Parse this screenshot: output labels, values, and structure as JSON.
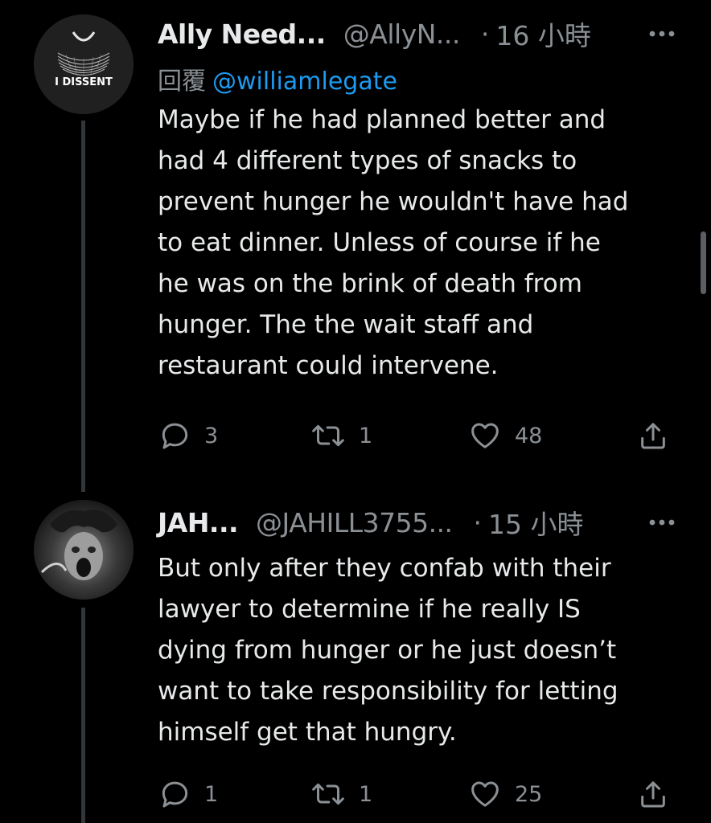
{
  "tweets": [
    {
      "name": "Ally Need...",
      "handle": "@AllyN...",
      "dot": "·",
      "time": "16 小時",
      "reply_prefix": "回覆",
      "reply_to": "@williamlegate",
      "avatar_text": "I DISSENT",
      "body": "Maybe if he had planned better and\nhad 4 different types of snacks to\nprevent hunger he wouldn't have had\nto eat dinner.  Unless of course if he\nhe was on the brink of death from\nhunger. The the wait staff and\nrestaurant could intervene.",
      "replies": "3",
      "retweets": "1",
      "likes": "48"
    },
    {
      "name": "JAH...",
      "handle": "@JAHILL3755...",
      "dot": "·",
      "time": "15 小時",
      "body": "But only after they confab with their\nlawyer to determine if he really IS\ndying from hunger or he just doesn’t\nwant to take responsibility for letting\nhimself get that hungry.",
      "replies": "1",
      "retweets": "1",
      "likes": "25"
    }
  ],
  "colors": {
    "background": "#000000",
    "text": "#e7e9ea",
    "muted": "#8b9095",
    "link": "#1d9bf0",
    "thread_line": "#333639"
  },
  "icons": [
    "more-icon",
    "reply-icon",
    "retweet-icon",
    "like-icon",
    "share-icon"
  ]
}
